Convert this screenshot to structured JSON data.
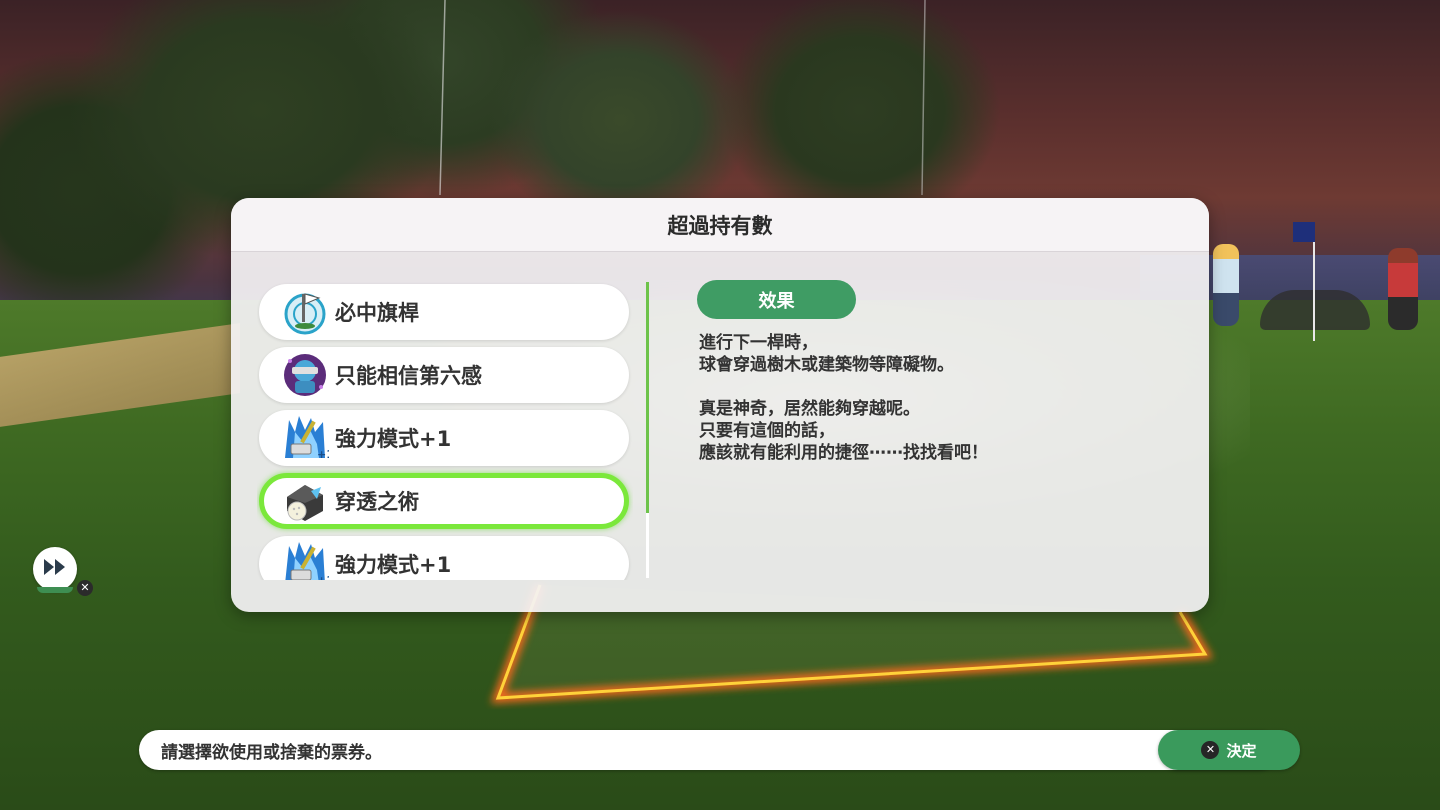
{
  "dialog": {
    "title": "超過持有數"
  },
  "tickets": [
    {
      "label": "必中旗桿",
      "icon": "flag-target-icon",
      "selected": false
    },
    {
      "label": "只能相信第六感",
      "icon": "blindfold-robot-icon",
      "selected": false
    },
    {
      "label": "強力模式+1",
      "icon": "power-club-icon",
      "selected": false
    },
    {
      "label": "穿透之術",
      "icon": "phase-ball-icon",
      "selected": true
    },
    {
      "label": "強力模式+1",
      "icon": "power-club-icon",
      "selected": false
    }
  ],
  "effect": {
    "badge": "效果",
    "lines": [
      "進行下一桿時，",
      "球會穿過樹木或建築物等障礙物。",
      "",
      "真是神奇，居然能夠穿越呢。",
      "只要有這個的話，",
      "應該就有能利用的捷徑⋯⋯找找看吧！"
    ]
  },
  "skip": {
    "icon": "fast-forward-icon",
    "button_glyph": "✕"
  },
  "footer": {
    "instruction": "請選擇欲使用或捨棄的票券。",
    "confirm_glyph": "✕",
    "confirm_label": "決定"
  },
  "colors": {
    "accent_green": "#3f9c64",
    "selection_green": "#7be83b",
    "course_line": "#ff6a1a"
  }
}
